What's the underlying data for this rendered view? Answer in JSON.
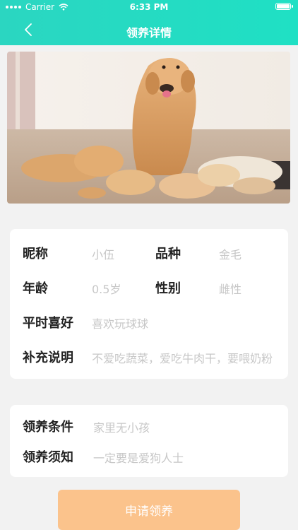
{
  "status": {
    "carrier": "Carrier",
    "time": "6:33 PM"
  },
  "nav": {
    "title": "领养详情"
  },
  "photo": {
    "alt": "金毛母犬与幼犬"
  },
  "info": {
    "nickname_label": "昵称",
    "nickname_value": "小伍",
    "breed_label": "品种",
    "breed_value": "金毛",
    "age_label": "年龄",
    "age_value": "0.5岁",
    "gender_label": "性别",
    "gender_value": "雌性",
    "hobby_label": "平时喜好",
    "hobby_value": "喜欢玩球球",
    "notes_label": "补充说明",
    "notes_value": "不爱吃蔬菜，爱吃牛肉干，要喂奶粉"
  },
  "adopt": {
    "condition_label": "领养条件",
    "condition_value": "家里无小孩",
    "notice_label": "领养须知",
    "notice_value": "一定要是爱狗人士"
  },
  "apply_button": "申请领养"
}
